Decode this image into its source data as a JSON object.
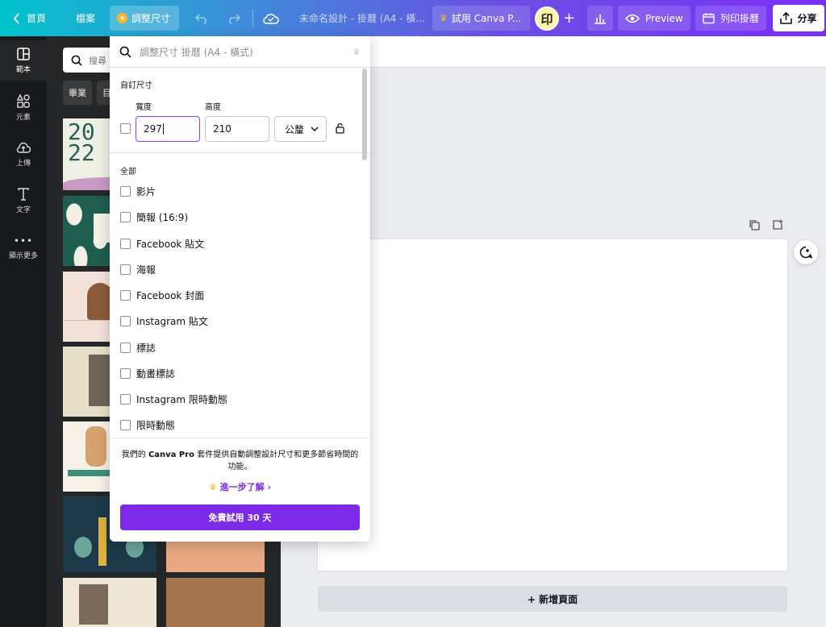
{
  "topbar": {
    "home_label": "首頁",
    "file_label": "檔案",
    "resize_label": "調整尺寸",
    "doc_title": "未命名設計 - 掛曆 (A4 - 橫...",
    "try_pro_label": "試用 Canva P...",
    "avatar_text": "印",
    "preview_label": "Preview",
    "print_label": "列印掛曆",
    "share_label": "分享"
  },
  "rail": {
    "items": [
      {
        "label": "範本",
        "icon": "template-icon"
      },
      {
        "label": "元素",
        "icon": "elements-icon"
      },
      {
        "label": "上傳",
        "icon": "upload-icon"
      },
      {
        "label": "文字",
        "icon": "text-icon"
      },
      {
        "label": "顯示更多",
        "icon": "more-icon"
      }
    ]
  },
  "panel": {
    "search_placeholder": "搜尋",
    "chips": [
      "畢業",
      "目"
    ]
  },
  "dropdown": {
    "search_placeholder": "調整尺寸 掛曆 (A4 - 橫式)",
    "custom_size_title": "自訂尺寸",
    "width_label": "寬度",
    "height_label": "高度",
    "width_value": "297",
    "height_value": "210",
    "unit": "公釐",
    "all_label": "全部",
    "sizes": [
      "影片",
      "簡報 (16:9)",
      "Facebook 貼文",
      "海報",
      "Facebook 封面",
      "Instagram 貼文",
      "標誌",
      "動畫標誌",
      "Instagram 限時動態",
      "限時動態"
    ],
    "promo_prefix": "我們的 ",
    "promo_brand": "Canva Pro",
    "promo_suffix": " 套件提供自動調整設計尺寸和更多節省時間的功能。",
    "learn_more": "進一步了解",
    "trial_button": "免費試用 30 天"
  },
  "canvas": {
    "add_page_label": "+ 新增頁面"
  },
  "colors": {
    "accent": "#7d2ae8",
    "rail_bg": "#18191b",
    "panel_bg": "#252627"
  }
}
